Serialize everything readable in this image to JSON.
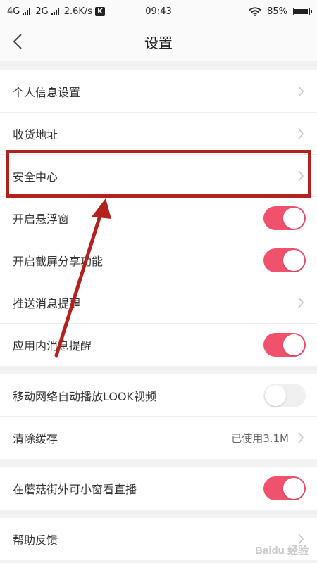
{
  "status_bar": {
    "net1": "4G",
    "net2": "2G",
    "speed": "2.6K/s",
    "badge": "K",
    "time": "09:43",
    "battery": "85%",
    "battery_level": 0.85
  },
  "header": {
    "title": "设置"
  },
  "groups": [
    {
      "rows": [
        {
          "label": "个人信息设置",
          "control": "chevron"
        },
        {
          "label": "收货地址",
          "control": "chevron"
        },
        {
          "label": "安全中心",
          "control": "chevron"
        },
        {
          "label": "开启悬浮窗",
          "control": "toggle",
          "on": true
        },
        {
          "label": "开启截屏分享功能",
          "control": "toggle",
          "on": true
        },
        {
          "label": "推送消息提醒",
          "control": "chevron"
        },
        {
          "label": "应用内消息提醒",
          "control": "toggle",
          "on": true
        }
      ]
    },
    {
      "rows": [
        {
          "label": "移动网络自动播放LOOK视频",
          "control": "toggle",
          "on": false
        },
        {
          "label": "清除缓存",
          "control": "chevron",
          "value": "已使用3.1M"
        }
      ]
    },
    {
      "rows": [
        {
          "label": "在蘑菇街外可小窗看直播",
          "control": "toggle",
          "on": true
        }
      ]
    },
    {
      "rows": [
        {
          "label": "帮助反馈",
          "control": "chevron"
        }
      ]
    }
  ],
  "colors": {
    "toggle_on": "#f0516d",
    "annotation": "#b3211f"
  },
  "watermark": "Baidu 经验"
}
